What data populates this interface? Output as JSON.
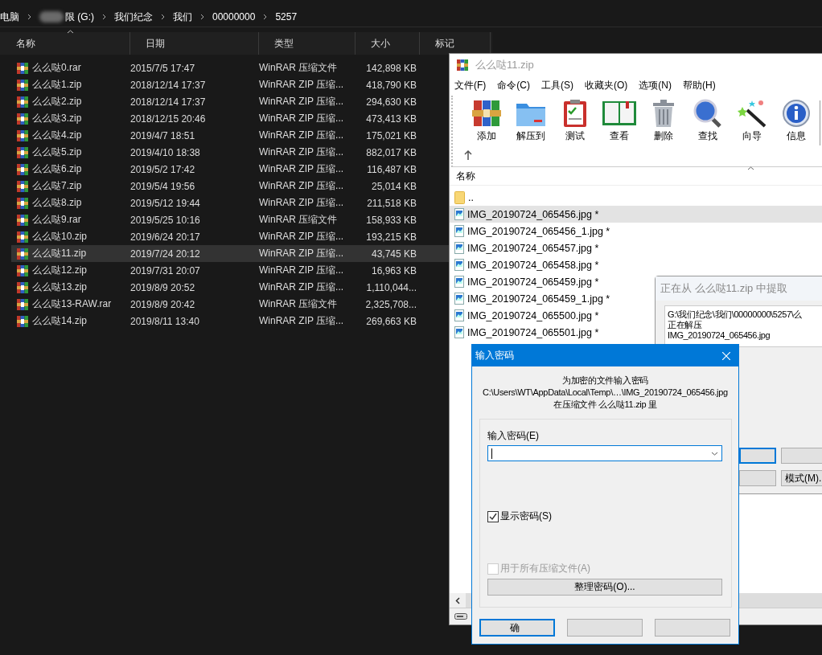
{
  "explorer": {
    "breadcrumb": [
      "电脑",
      "限 (G:)",
      "我们纪念",
      "我们",
      "00000000",
      "5257"
    ],
    "columns": [
      "名称",
      "日期",
      "类型",
      "大小",
      "标记"
    ],
    "rows": [
      {
        "name": "么么哒0.rar",
        "date": "2015/7/5 17:47",
        "type": "WinRAR 压缩文件",
        "size": "142,898 KB",
        "selected": false
      },
      {
        "name": "么么哒1.zip",
        "date": "2018/12/14 17:37",
        "type": "WinRAR ZIP 压缩...",
        "size": "418,790 KB",
        "selected": false
      },
      {
        "name": "么么哒2.zip",
        "date": "2018/12/14 17:37",
        "type": "WinRAR ZIP 压缩...",
        "size": "294,630 KB",
        "selected": false
      },
      {
        "name": "么么哒3.zip",
        "date": "2018/12/15 20:46",
        "type": "WinRAR ZIP 压缩...",
        "size": "473,413 KB",
        "selected": false
      },
      {
        "name": "么么哒4.zip",
        "date": "2019/4/7 18:51",
        "type": "WinRAR ZIP 压缩...",
        "size": "175,021 KB",
        "selected": false
      },
      {
        "name": "么么哒5.zip",
        "date": "2019/4/10 18:38",
        "type": "WinRAR ZIP 压缩...",
        "size": "882,017 KB",
        "selected": false
      },
      {
        "name": "么么哒6.zip",
        "date": "2019/5/2 17:42",
        "type": "WinRAR ZIP 压缩...",
        "size": "116,487 KB",
        "selected": false
      },
      {
        "name": "么么哒7.zip",
        "date": "2019/5/4 19:56",
        "type": "WinRAR ZIP 压缩...",
        "size": "25,014 KB",
        "selected": false
      },
      {
        "name": "么么哒8.zip",
        "date": "2019/5/12 19:44",
        "type": "WinRAR ZIP 压缩...",
        "size": "211,518 KB",
        "selected": false
      },
      {
        "name": "么么哒9.rar",
        "date": "2019/5/25 10:16",
        "type": "WinRAR 压缩文件",
        "size": "158,933 KB",
        "selected": false
      },
      {
        "name": "么么哒10.zip",
        "date": "2019/6/24 20:17",
        "type": "WinRAR ZIP 压缩...",
        "size": "193,215 KB",
        "selected": false
      },
      {
        "name": "么么哒11.zip",
        "date": "2019/7/24 20:12",
        "type": "WinRAR ZIP 压缩...",
        "size": "43,745 KB",
        "selected": true
      },
      {
        "name": "么么哒12.zip",
        "date": "2019/7/31 20:07",
        "type": "WinRAR ZIP 压缩...",
        "size": "16,963 KB",
        "selected": false
      },
      {
        "name": "么么哒13.zip",
        "date": "2019/8/9 20:52",
        "type": "WinRAR ZIP 压缩...",
        "size": "1,110,044...",
        "selected": false
      },
      {
        "name": "么么哒13-RAW.rar",
        "date": "2019/8/9 20:42",
        "type": "WinRAR 压缩文件",
        "size": "2,325,708...",
        "selected": false
      },
      {
        "name": "么么哒14.zip",
        "date": "2019/8/11 13:40",
        "type": "WinRAR ZIP 压缩...",
        "size": "269,663 KB",
        "selected": false
      }
    ]
  },
  "winrar": {
    "title": "么么哒11.zip",
    "menu": [
      "文件(F)",
      "命令(C)",
      "工具(S)",
      "收藏夹(O)",
      "选项(N)",
      "帮助(H)"
    ],
    "toolbar": [
      {
        "label": "添加",
        "kind": "add"
      },
      {
        "label": "解压到",
        "kind": "extract"
      },
      {
        "label": "测试",
        "kind": "test"
      },
      {
        "label": "查看",
        "kind": "view"
      },
      {
        "label": "删除",
        "kind": "delete"
      },
      {
        "label": "查找",
        "kind": "find"
      },
      {
        "label": "向导",
        "kind": "wizard"
      },
      {
        "label": "信息",
        "kind": "info"
      }
    ],
    "column": "名称",
    "files": [
      {
        "name": "..",
        "kind": "folder",
        "selected": false
      },
      {
        "name": "IMG_20190724_065456.jpg *",
        "kind": "image",
        "selected": true
      },
      {
        "name": "IMG_20190724_065456_1.jpg *",
        "kind": "image",
        "selected": false
      },
      {
        "name": "IMG_20190724_065457.jpg *",
        "kind": "image",
        "selected": false
      },
      {
        "name": "IMG_20190724_065458.jpg *",
        "kind": "image",
        "selected": false
      },
      {
        "name": "IMG_20190724_065459.jpg *",
        "kind": "image",
        "selected": false
      },
      {
        "name": "IMG_20190724_065459_1.jpg *",
        "kind": "image",
        "selected": false
      },
      {
        "name": "IMG_20190724_065500.jpg *",
        "kind": "image",
        "selected": false
      },
      {
        "name": "IMG_20190724_065501.jpg *",
        "kind": "image",
        "selected": false
      }
    ]
  },
  "extract_dialog": {
    "title": "正在从 么么哒11.zip 中提取",
    "path": "G:\\我们纪念\\我们\\00000000\\5257\\么",
    "status": "正在解压",
    "file": "IMG_20190724_065456.jpg",
    "mode_button": "模式(M)."
  },
  "password_dialog": {
    "title": "输入密码",
    "message": [
      "为加密的文件输入密码",
      "C:\\Users\\WT\\AppData\\Local\\Temp\\…\\IMG_20190724_065456.jpg",
      "在压缩文件 么么哒11.zip 里"
    ],
    "field_label": "输入密码(E)",
    "show_password": {
      "label": "显示密码(S)",
      "checked": true
    },
    "all_archives": {
      "label": "用于所有压缩文件(A)",
      "checked": false,
      "disabled": true
    },
    "organize_button": "整理密码(O)...",
    "ok_button": "确"
  }
}
